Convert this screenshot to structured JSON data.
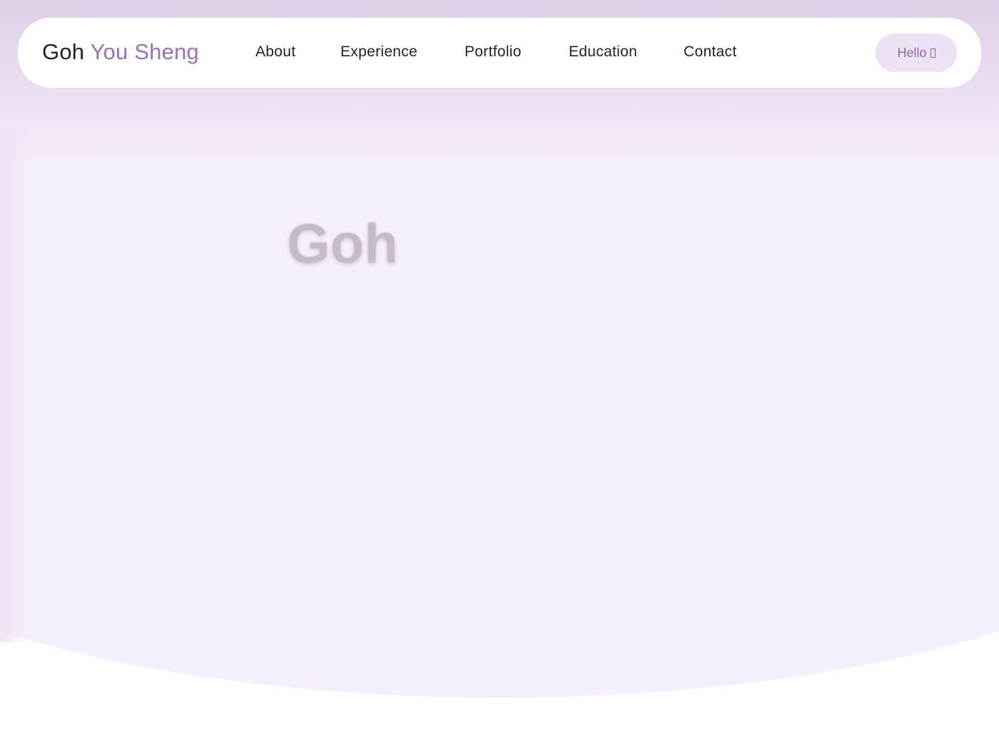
{
  "navbar": {
    "brand_first": "Goh",
    "brand_rest": "You Sheng",
    "items": [
      {
        "label": "About"
      },
      {
        "label": "Experience"
      },
      {
        "label": "Portfolio"
      },
      {
        "label": "Education"
      },
      {
        "label": "Contact"
      }
    ],
    "cta_label": "Hello",
    "cta_icon": "unknown-glyph-icon"
  },
  "hero": {
    "title_visible": "Goh"
  },
  "colors": {
    "brand_accent": "#9b72ac",
    "text_dark": "#222222",
    "hero_background": "#f6effd",
    "button_background": "#ede2f3",
    "hero_title": "#c5bac9"
  }
}
